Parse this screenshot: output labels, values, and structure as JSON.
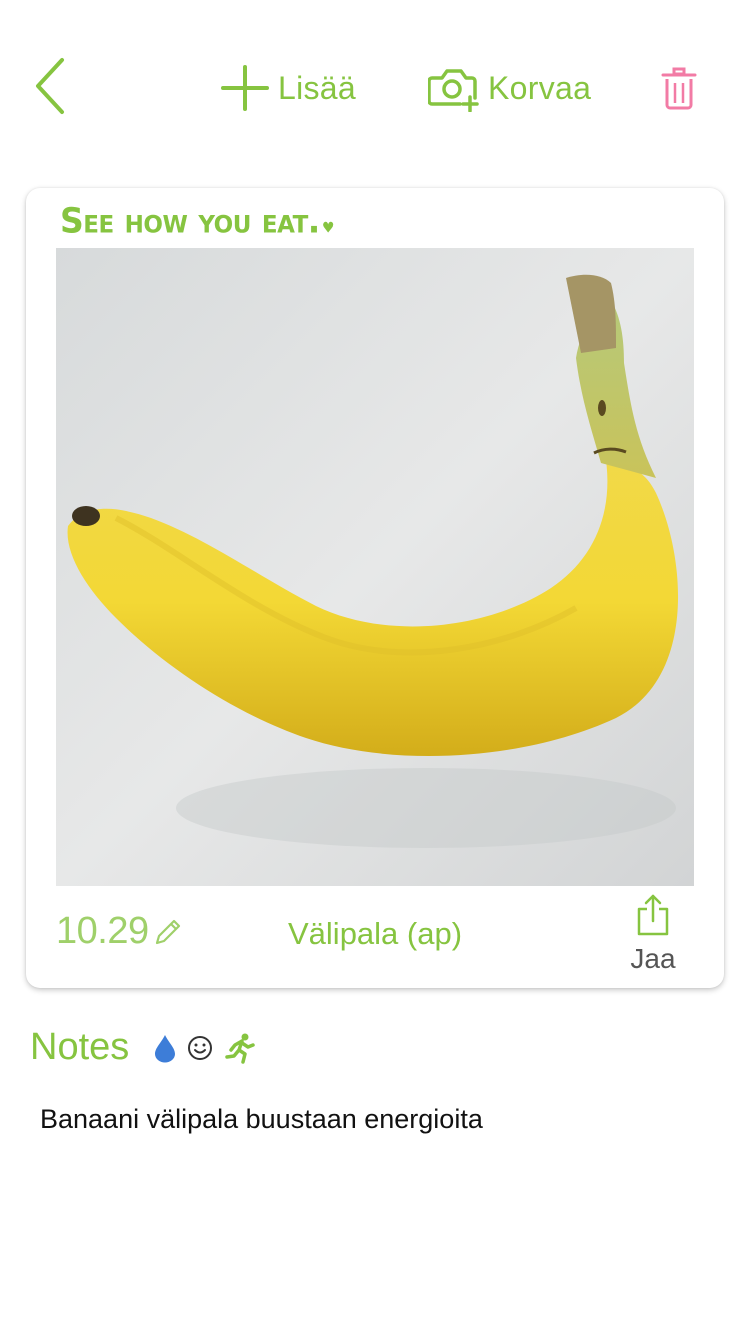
{
  "colors": {
    "accent": "#86c440",
    "delete": "#f27ba5",
    "water": "#3d7dd8"
  },
  "toolbar": {
    "back_icon": "chevron-left-icon",
    "add_label": "Lisää",
    "replace_label": "Korvaa",
    "delete_icon": "trash-icon"
  },
  "card": {
    "brand": "See how you eat.",
    "photo_description": "banana",
    "time": "10.29",
    "meal_type": "Välipala (ap)",
    "share_label": "Jaa"
  },
  "notes": {
    "title": "Notes",
    "icons": [
      "water-drop-icon",
      "smiley-icon",
      "running-icon"
    ],
    "text": "Banaani välipala buustaan energioita"
  }
}
